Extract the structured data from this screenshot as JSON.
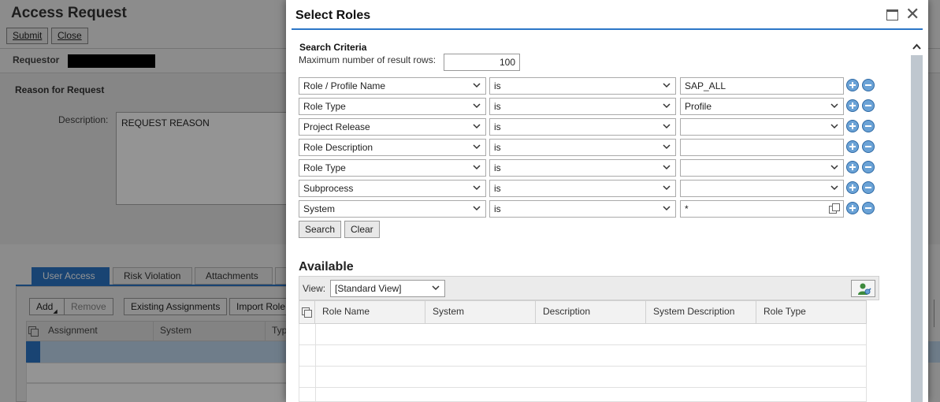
{
  "background": {
    "title": "Access Request",
    "submit_label": "Submit",
    "close_label": "Close",
    "requestor_label": "Requestor",
    "reason_heading": "Reason for Request",
    "description_label": "Description:",
    "description_value": "REQUEST REASON",
    "tabs": [
      {
        "label": "User Access"
      },
      {
        "label": "Risk Violation"
      },
      {
        "label": "Attachments"
      }
    ],
    "toolbar": {
      "add_label": "Add",
      "remove_label": "Remove",
      "existing_label": "Existing Assignments",
      "import_label": "Import Role"
    },
    "table_headers": [
      "Assignment",
      "System",
      "Typ"
    ]
  },
  "dialog": {
    "title": "Select Roles",
    "search_criteria_title": "Search Criteria",
    "max_rows_label": "Maximum number of result rows:",
    "max_rows_value": "100",
    "criteria": [
      {
        "field": "Role / Profile Name",
        "operator": "is",
        "value": "SAP_ALL",
        "value_type": "text"
      },
      {
        "field": "Role Type",
        "operator": "is",
        "value": "Profile",
        "value_type": "select"
      },
      {
        "field": "Project Release",
        "operator": "is",
        "value": "",
        "value_type": "select"
      },
      {
        "field": "Role Description",
        "operator": "is",
        "value": "",
        "value_type": "text"
      },
      {
        "field": "Role Type",
        "operator": "is",
        "value": "",
        "value_type": "select"
      },
      {
        "field": "Subprocess",
        "operator": "is",
        "value": "",
        "value_type": "select"
      },
      {
        "field": "System",
        "operator": "is",
        "value": "*",
        "value_type": "lookup"
      }
    ],
    "search_label": "Search",
    "clear_label": "Clear",
    "available_title": "Available",
    "view_label": "View:",
    "view_value": "[Standard View]",
    "columns": [
      "Role Name",
      "System",
      "Description",
      "System Description",
      "Role Type"
    ]
  },
  "colors": {
    "accent": "#2c76c7",
    "circle_button": "#6aa2d6"
  }
}
